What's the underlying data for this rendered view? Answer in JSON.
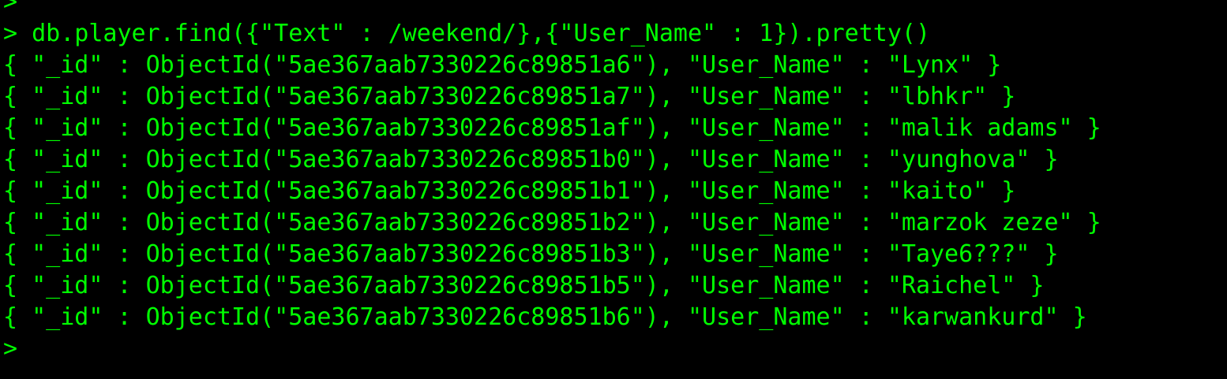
{
  "terminal": {
    "prompt_symbol": ">",
    "fg_color": "#00ff00",
    "bg_color": "#000000",
    "lines": [
      {
        "prompt": ">",
        "text": ""
      },
      {
        "prompt": ">",
        "text": " db.player.find({\"Text\" : /weekend/},{\"User_Name\" : 1}).pretty()"
      },
      {
        "prompt": "",
        "text": "{ \"_id\" : ObjectId(\"5ae367aab7330226c89851a6\"), \"User_Name\" : \"Lynx\" }"
      },
      {
        "prompt": "",
        "text": "{ \"_id\" : ObjectId(\"5ae367aab7330226c89851a7\"), \"User_Name\" : \"lbhkr\" }"
      },
      {
        "prompt": "",
        "text": "{ \"_id\" : ObjectId(\"5ae367aab7330226c89851af\"), \"User_Name\" : \"malik adams\" }"
      },
      {
        "prompt": "",
        "text": "{ \"_id\" : ObjectId(\"5ae367aab7330226c89851b0\"), \"User_Name\" : \"yunghova\" }"
      },
      {
        "prompt": "",
        "text": "{ \"_id\" : ObjectId(\"5ae367aab7330226c89851b1\"), \"User_Name\" : \"kaito\" }"
      },
      {
        "prompt": "",
        "text": "{ \"_id\" : ObjectId(\"5ae367aab7330226c89851b2\"), \"User_Name\" : \"marzok zeze\" }"
      },
      {
        "prompt": "",
        "text": "{ \"_id\" : ObjectId(\"5ae367aab7330226c89851b3\"), \"User_Name\" : \"Taye6???\" }"
      },
      {
        "prompt": "",
        "text": "{ \"_id\" : ObjectId(\"5ae367aab7330226c89851b5\"), \"User_Name\" : \"Raichel\" }"
      },
      {
        "prompt": "",
        "text": "{ \"_id\" : ObjectId(\"5ae367aab7330226c89851b6\"), \"User_Name\" : \"karwankurd\" }"
      },
      {
        "prompt": ">",
        "text": ""
      }
    ]
  }
}
